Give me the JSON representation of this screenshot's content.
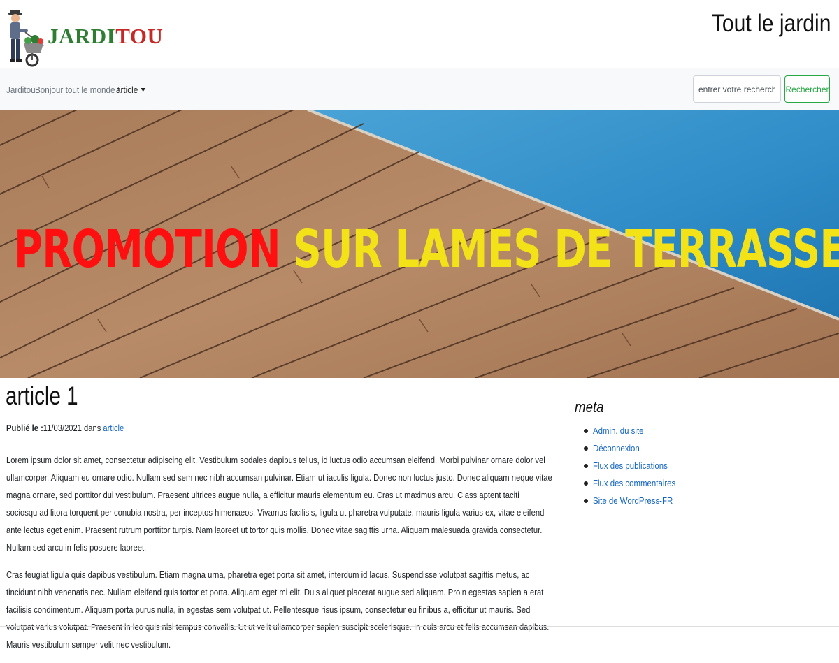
{
  "header": {
    "logo_part1": "JARDI",
    "logo_part2": "TOU",
    "tagline": "Tout le jardin"
  },
  "navbar": {
    "brand": "Jarditou",
    "home": "Bonjour tout le monde !",
    "dropdown": "article"
  },
  "search": {
    "placeholder": "entrer votre recherche",
    "button": "Rechercher"
  },
  "banner": {
    "word_red": "PROMOTION",
    "word_yellow": "SUR LAMES DE TERRASSE"
  },
  "article": {
    "title": "article 1",
    "published_label": "Publié le :",
    "date": "11/03/2021",
    "in_label": "dans",
    "category": "article",
    "paragraphs": [
      "Lorem ipsum dolor sit amet, consectetur adipiscing elit. Vestibulum sodales dapibus tellus, id luctus odio accumsan eleifend. Morbi pulvinar ornare dolor vel ullamcorper. Aliquam eu ornare odio. Nullam sed sem nec nibh accumsan pulvinar. Etiam ut iaculis ligula. Donec non luctus justo. Donec aliquam neque vitae magna ornare, sed porttitor dui vestibulum. Praesent ultrices augue nulla, a efficitur mauris elementum eu. Cras ut maximus arcu. Class aptent taciti sociosqu ad litora torquent per conubia nostra, per inceptos himenaeos. Vivamus facilisis, ligula ut pharetra vulputate, mauris ligula varius ex, vitae eleifend ante lectus eget enim. Praesent rutrum porttitor turpis. Nam laoreet ut tortor quis mollis. Donec vitae sagittis urna. Aliquam malesuada gravida consectetur. Nullam sed arcu in felis posuere laoreet.",
      "Cras feugiat ligula quis dapibus vestibulum. Etiam magna urna, pharetra eget porta sit amet, interdum id lacus. Suspendisse volutpat sagittis metus, ac tincidunt nibh venenatis nec. Nullam eleifend quis tortor et porta. Aliquam eget mi elit. Duis aliquet placerat augue sed aliquam. Proin egestas sapien a erat facilisis condimentum. Aliquam porta purus nulla, in egestas sem volutpat ut. Pellentesque risus ipsum, consectetur eu finibus a, efficitur ut mauris. Sed volutpat varius volutpat. Praesent in leo quis nisi tempus convallis. Ut ut velit ullamcorper sapien suscipit scelerisque. In quis arcu et felis accumsan dapibus. Mauris vestibulum semper velit nec vestibulum."
    ]
  },
  "sidebar": {
    "title": "meta",
    "links": [
      "Admin. du site",
      "Déconnexion",
      "Flux des publications",
      "Flux des commentaires",
      "Site de WordPress-FR"
    ]
  },
  "colors": {
    "banner_red": "#ff1010",
    "banner_yellow": "#f3e218",
    "link": "#1565c0",
    "search_button": "#28a745",
    "logo_green": "#2e7d32",
    "logo_red": "#c62828"
  },
  "icons": {
    "logo": "gardener-wheelbarrow-icon",
    "dropdown": "caret-down-icon"
  }
}
